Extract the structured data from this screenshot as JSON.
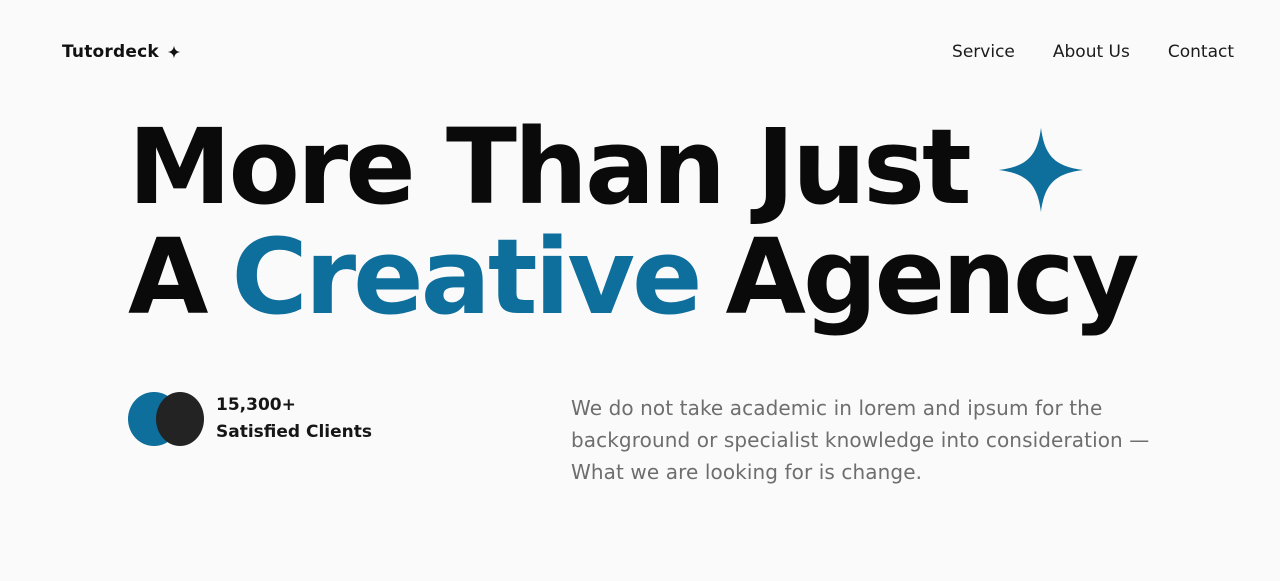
{
  "brand": {
    "name": "Tutordeck",
    "icon": "sparkle-icon"
  },
  "nav": {
    "items": [
      {
        "label": "Service"
      },
      {
        "label": "About Us"
      },
      {
        "label": "Contact"
      }
    ]
  },
  "hero": {
    "line1": "More Than Just",
    "line2_prefix": "A",
    "line2_accent": "Creative",
    "line2_suffix": "Agency",
    "star_icon": "sparkle-icon"
  },
  "stats": {
    "count": "15,300+",
    "label": "Satisfied Clients"
  },
  "description": {
    "text": "We do not take academic in lorem and ipsum for the background or specialist knowledge into consideration — What we are looking for is change."
  },
  "colors": {
    "accent": "#0e6e9c",
    "dark": "#232323",
    "background": "#fafafa",
    "muted_text": "#6e6e6e"
  }
}
